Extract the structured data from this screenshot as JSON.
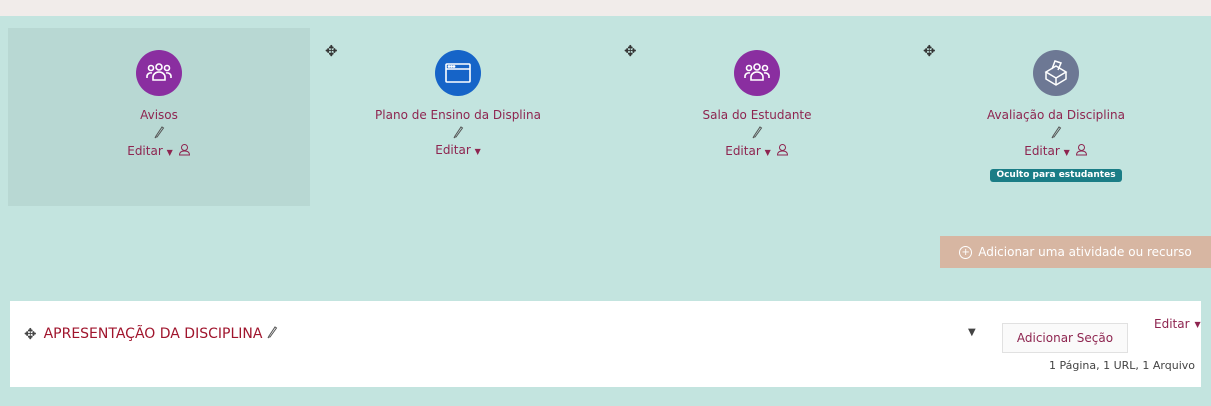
{
  "activities": [
    {
      "title": "Avisos",
      "editor_label": "Editar",
      "has_user_icon": true,
      "icon": "forum-people-icon",
      "color": "#8a2ea0",
      "badge": ""
    },
    {
      "title": "Plano de Ensino da Displina",
      "editor_label": "Editar",
      "has_user_icon": false,
      "icon": "browser-window-icon",
      "color": "#1664c8",
      "badge": ""
    },
    {
      "title": "Sala do Estudante",
      "editor_label": "Editar",
      "has_user_icon": true,
      "icon": "forum-people-icon",
      "color": "#8a2ea0",
      "badge": ""
    },
    {
      "title": "Avaliação da Disciplina",
      "editor_label": "Editar",
      "has_user_icon": true,
      "icon": "ballot-box-icon",
      "color": "#6d7894",
      "badge": "Oculto para estudantes"
    }
  ],
  "add_activity_label": "Adicionar uma atividade ou recurso",
  "section": {
    "title": "APRESENTAÇÃO DA DISCIPLINA",
    "add_section_label": "Adicionar Seção",
    "editor_label": "Editar",
    "summary": "1 Página, 1 URL, 1 Arquivo"
  }
}
